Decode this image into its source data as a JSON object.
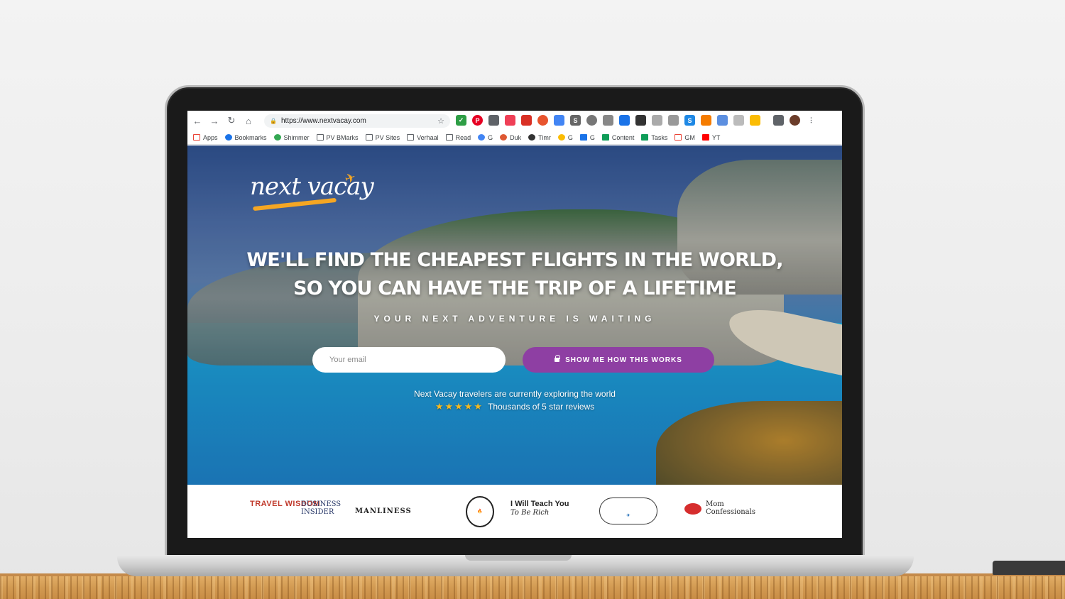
{
  "browser": {
    "url": "https://www.nextvacay.com",
    "bookmarks": [
      "Apps",
      "Bookmarks",
      "Shimmer",
      "PV BMarks",
      "PV Sites",
      "Verhaal",
      "Read",
      "G",
      "Duk",
      "Timr",
      "G",
      "G",
      "Content",
      "Tasks",
      "GM",
      "YT"
    ]
  },
  "hero": {
    "logo_text": "next vacay",
    "headline_line1": "WE'LL FIND THE CHEAPEST FLIGHTS IN THE WORLD,",
    "headline_line2": "SO YOU CAN HAVE THE TRIP OF A LIFETIME",
    "subheadline": "YOUR NEXT ADVENTURE IS WAITING",
    "email_placeholder": "Your email",
    "cta_label": "SHOW ME HOW THIS WORKS",
    "explore_text": "Next Vacay travelers are currently exploring the world",
    "stars": "★★★★★",
    "reviews_text": "Thousands of 5 star reviews"
  },
  "press": {
    "travel_wisdom": "TRAVEL WISDOM",
    "business_insider_1": "BUSINESS",
    "business_insider_2": "INSIDER",
    "manliness": "MANLINESS",
    "iwt_1": "I Will Teach You",
    "iwt_2": "To Be Rich",
    "mom_1": "Mom",
    "mom_2": "Confessionals"
  },
  "colors": {
    "cta": "#8e3fa3",
    "stars": "#f5b921",
    "logo_accent": "#f5a623"
  }
}
